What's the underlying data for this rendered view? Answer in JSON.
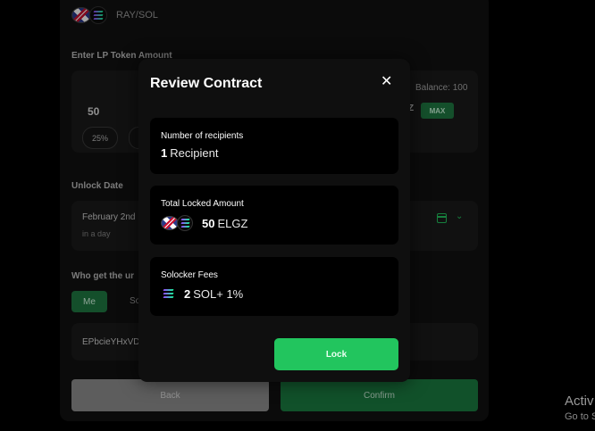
{
  "background": {
    "pair_label": "RAY/SOL",
    "lp_section_label": "Enter LP Token Amount",
    "lp_amount": "50",
    "pct_25": "25%",
    "balance_text": "Balance: 100",
    "ticker_tail": "Z",
    "max_label": "MAX",
    "unlock_section_label": "Unlock Date",
    "unlock_date": "February 2nd",
    "unlock_relative": "in a day",
    "recipient_section_label": "Who get the ur",
    "toggle_me": "Me",
    "toggle_other": "So",
    "address": "EPbcieYHxVD",
    "back_label": "Back",
    "confirm_label": "Confirm"
  },
  "modal": {
    "title": "Review Contract",
    "recipients": {
      "label": "Number of recipients",
      "count": "1",
      "unit": "Recipient"
    },
    "locked": {
      "label": "Total Locked Amount",
      "amount": "50",
      "token": "ELGZ"
    },
    "fees": {
      "label": "Solocker Fees",
      "sol": "2",
      "rest": "SOL+ 1%"
    },
    "lock_label": "Lock"
  },
  "watermark": {
    "line1": "Activ",
    "line2": "Go to S"
  },
  "colors": {
    "accent": "#22c55e",
    "accent_dark": "#1b7d41",
    "modal_bg": "#0f0f0f"
  }
}
